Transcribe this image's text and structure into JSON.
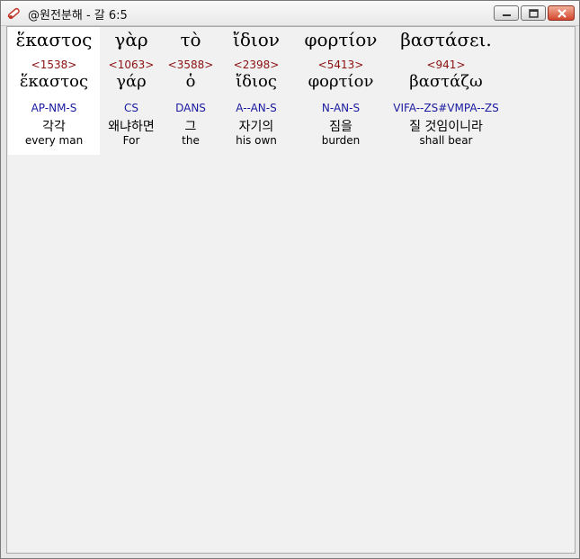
{
  "window": {
    "title": "@원전분해 - 갈 6:5"
  },
  "words": [
    {
      "greek": "ἕκαστος",
      "strong": "<1538>",
      "lemma": "ἕκαστος",
      "parse": "AP-NM-S",
      "korean": "각각",
      "english": "every man"
    },
    {
      "greek": "γὰρ",
      "strong": "<1063>",
      "lemma": "γάρ",
      "parse": "CS",
      "korean": "왜냐하면",
      "english": "For"
    },
    {
      "greek": "τὸ",
      "strong": "<3588>",
      "lemma": "ὁ",
      "parse": "DANS",
      "korean": "그",
      "english": "the"
    },
    {
      "greek": "ἴδιον",
      "strong": "<2398>",
      "lemma": "ἴδιος",
      "parse": "A--AN-S",
      "korean": "자기의",
      "english": "his own"
    },
    {
      "greek": "φορτίον",
      "strong": "<5413>",
      "lemma": "φορτίον",
      "parse": "N-AN-S",
      "korean": "짐을",
      "english": "burden"
    },
    {
      "greek": "βαστάσει.",
      "strong": "<941>",
      "lemma": "βαστάζω",
      "parse": "VIFA--ZS#VMPA--ZS",
      "korean": "질 것임이니라",
      "english": "shall bear"
    }
  ],
  "icons": {
    "app": "app-tool-icon",
    "minimize": "minimize-icon",
    "maximize": "maximize-icon",
    "close": "close-icon"
  },
  "colors": {
    "strong_number": "#8b1010",
    "parsing_code": "#1a1aa0",
    "selected_background": "#ffffff",
    "client_background": "#f1f1f1"
  }
}
